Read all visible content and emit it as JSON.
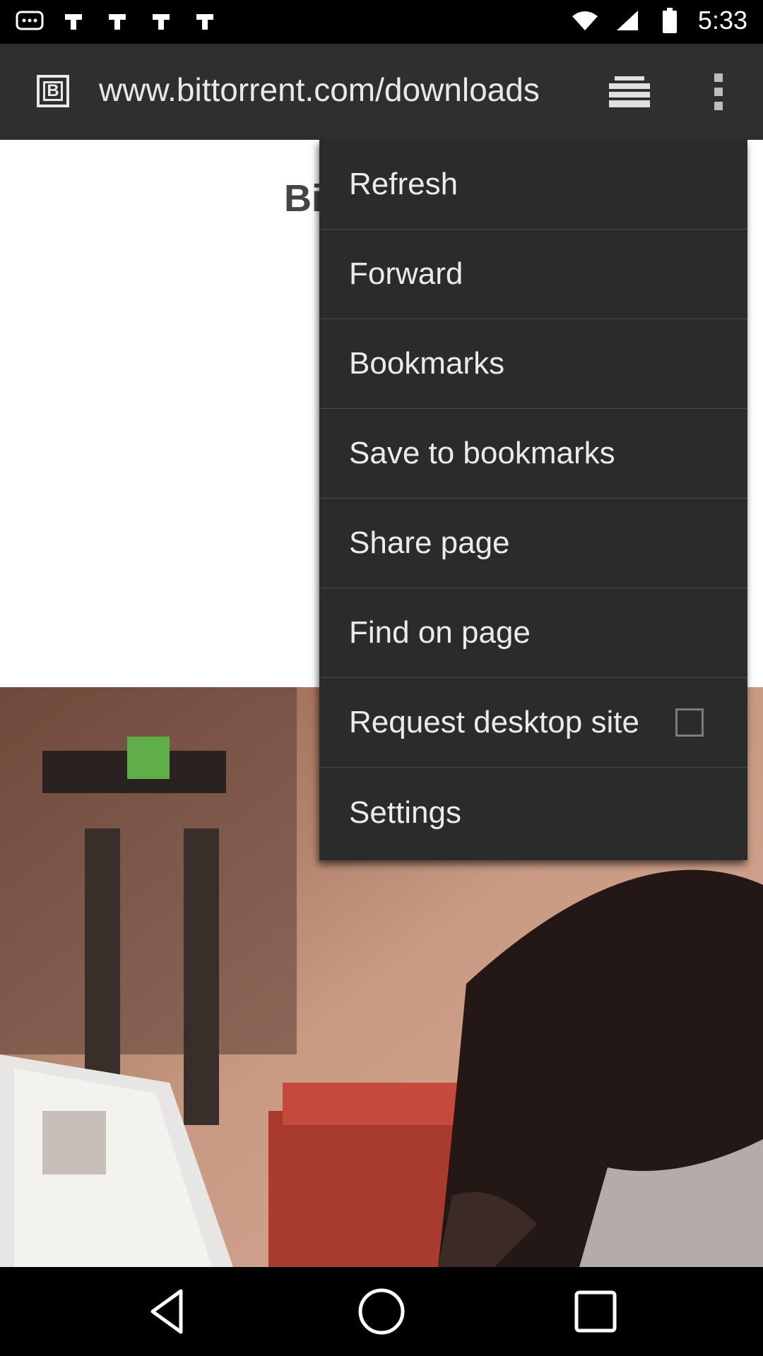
{
  "status_bar": {
    "time": "5:33",
    "icons": [
      "messages-icon",
      "notification-icon",
      "notification-icon",
      "notification-icon",
      "notification-icon",
      "wifi-icon",
      "signal-icon",
      "battery-icon"
    ]
  },
  "app_bar": {
    "url": "www.bittorrent.com/downloads",
    "site_icon_letter": "B"
  },
  "page": {
    "peek_text": "Bi"
  },
  "menu": {
    "items": [
      {
        "label": "Refresh"
      },
      {
        "label": "Forward"
      },
      {
        "label": "Bookmarks"
      },
      {
        "label": "Save to bookmarks"
      },
      {
        "label": "Share page"
      },
      {
        "label": "Find on page"
      },
      {
        "label": "Request desktop site",
        "checked": false
      },
      {
        "label": "Settings"
      }
    ]
  },
  "nav_bar": {
    "buttons": [
      "back-icon",
      "home-icon",
      "recents-icon"
    ]
  }
}
